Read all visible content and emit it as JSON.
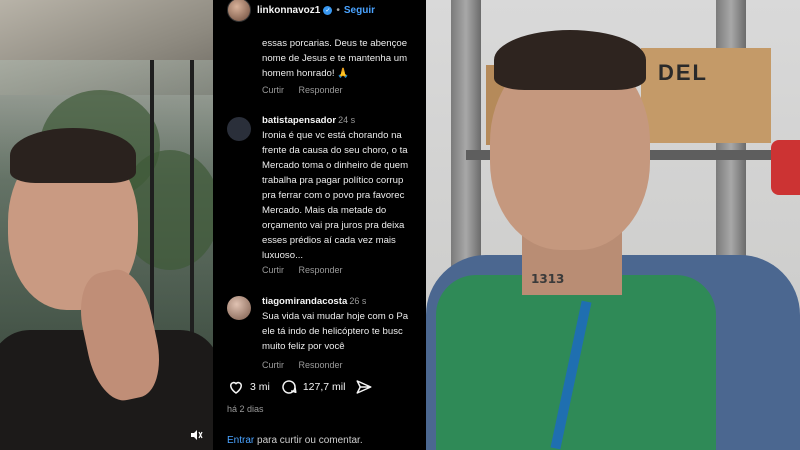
{
  "post": {
    "username": "linkonnavoz1",
    "separator": "•",
    "follow_label": "Seguir"
  },
  "comments": [
    {
      "user": "",
      "time": "",
      "lines": [
        "essas porcarias. Deus te abençoe",
        "nome de Jesus e te mantenha um",
        "homem honrado! 🙏"
      ],
      "reply_label": "Curtir",
      "answer_label": "Responder"
    },
    {
      "user": "batistapensador",
      "time": "24 s",
      "lines": [
        "Ironia é que vc está chorando na",
        "frente da causa do seu choro, o ta",
        "Mercado toma o dinheiro de quem",
        "trabalha pra pagar político corrup",
        "pra ferrar com o povo pra favorec",
        "Mercado. Mais da metade do",
        "orçamento vai pra juros pra deixa",
        "esses prédios aí cada vez mais",
        "luxuoso..."
      ],
      "reply_label": "Curtir",
      "answer_label": "Responder"
    },
    {
      "user": "tiagomirandacosta",
      "time": "26 s",
      "lines": [
        "Sua vida vai mudar hoje com o Pa",
        "ele tá indo de helicóptero te busc",
        "muito feliz por você"
      ],
      "reply_label": "Curtir",
      "answer_label": "Responder"
    }
  ],
  "actions": {
    "likes": "3 mi",
    "comments": "127,7 mil"
  },
  "time_ago": "há 2 dias",
  "login": {
    "link": "Entrar",
    "text": " para curtir ou comentar."
  },
  "photo_right": {
    "box_label": "DEL",
    "neck_tattoo": "1313"
  },
  "colors": {
    "link_blue": "#4aa3ff",
    "verified_blue": "#3897f0",
    "vest_green": "#2f8a57",
    "background": "#000000"
  },
  "icons": {
    "like": "heart-icon",
    "comment": "comment-bubble-icon",
    "share": "send-icon",
    "verified": "verified-badge-icon",
    "volume": "speaker-icon"
  }
}
